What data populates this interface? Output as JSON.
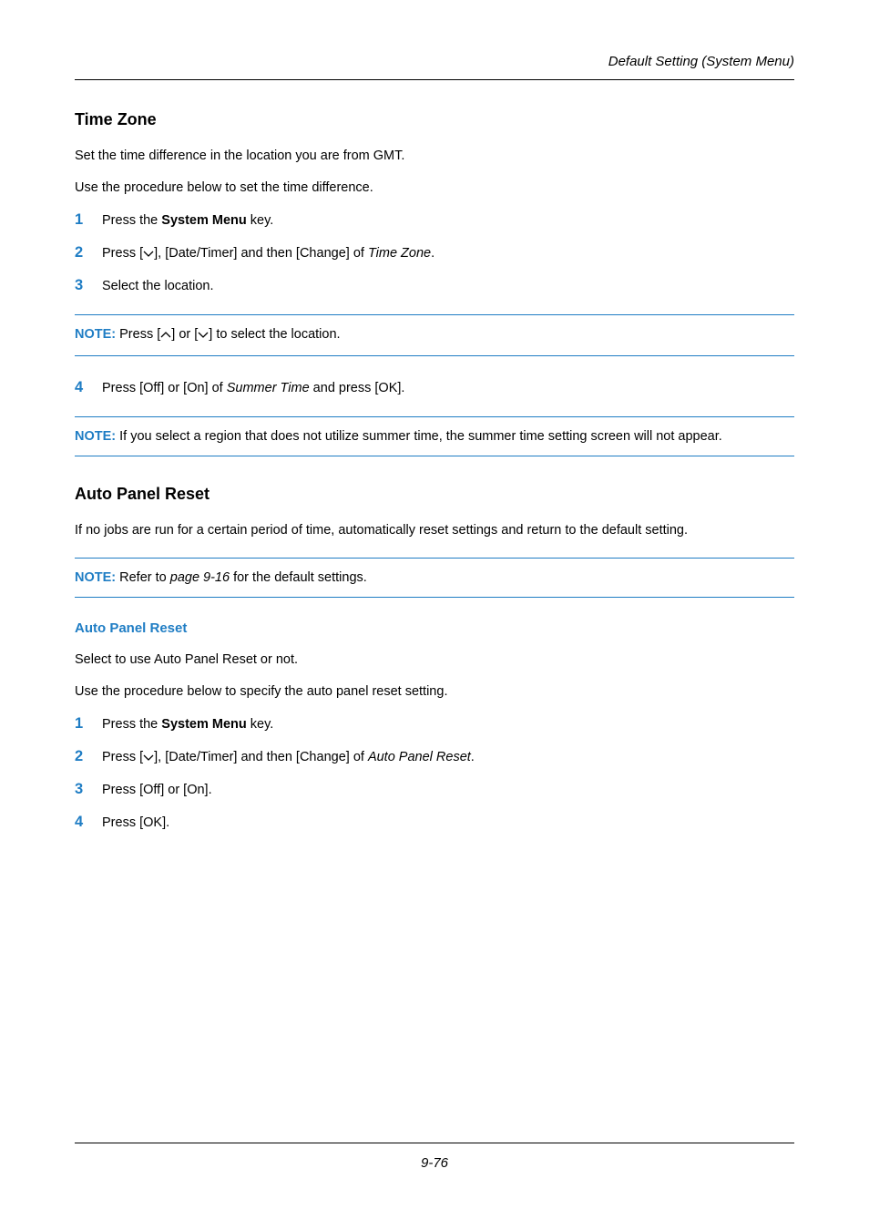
{
  "header": {
    "running_title": "Default Setting (System Menu)"
  },
  "section1": {
    "title": "Time Zone",
    "intro1": "Set the time difference in the location you are from GMT.",
    "intro2": "Use the procedure below to set the time difference.",
    "steps": [
      {
        "pre": "Press the ",
        "bold": "System Menu",
        "post": " key."
      },
      {
        "txt_a": "Press [",
        "txt_b": "], [Date/Timer] and then [Change] of ",
        "italic": "Time Zone",
        "txt_c": "."
      },
      {
        "plain": "Select the location."
      }
    ],
    "note1_label": "NOTE:",
    "note1_a": " Press [",
    "note1_b": "] or [",
    "note1_c": "] to select the location.",
    "step4_a": "Press [Off] or [On] of ",
    "step4_italic": "Summer Time",
    "step4_b": " and press [OK].",
    "note2_label": "NOTE:",
    "note2_text": " If you select a region that does not utilize summer time, the summer time setting screen will not appear."
  },
  "section2": {
    "title": "Auto Panel Reset",
    "intro": "If no jobs are run for a certain period of time, automatically reset settings and return to the default setting.",
    "note_label": "NOTE:",
    "note_a": " Refer to ",
    "note_italic": "page 9-16",
    "note_b": " for the default settings.",
    "sub_title": "Auto Panel Reset",
    "sub_intro1": "Select to use Auto Panel Reset or not.",
    "sub_intro2": "Use the procedure below to specify the auto panel reset setting.",
    "steps": [
      {
        "pre": "Press the ",
        "bold": "System Menu",
        "post": " key."
      },
      {
        "txt_a": "Press [",
        "txt_b": "], [Date/Timer] and then [Change] of ",
        "italic": "Auto Panel Reset",
        "txt_c": "."
      },
      {
        "plain": "Press [Off] or [On]."
      },
      {
        "plain": "Press [OK]."
      }
    ]
  },
  "footer": {
    "page": "9-76"
  }
}
